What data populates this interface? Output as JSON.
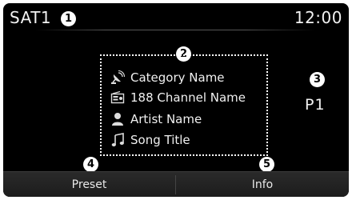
{
  "status": {
    "source": "SAT1",
    "time": "12:00"
  },
  "info": {
    "category": {
      "icon": "satellite-dish-icon",
      "label": "Category Name"
    },
    "channel": {
      "icon": "radio-icon",
      "label": "188 Channel Name"
    },
    "artist": {
      "icon": "person-icon",
      "label": "Artist Name"
    },
    "song": {
      "icon": "music-note-icon",
      "label": "Song Title"
    }
  },
  "preset_indicator": "P1",
  "bottom_bar": {
    "preset_label": "Preset",
    "info_label": "Info"
  },
  "callouts": [
    "1",
    "2",
    "3",
    "4",
    "5"
  ],
  "colors": {
    "screen_background": "#000000",
    "text": "#ffffff",
    "bottom_bar": "#222222"
  }
}
